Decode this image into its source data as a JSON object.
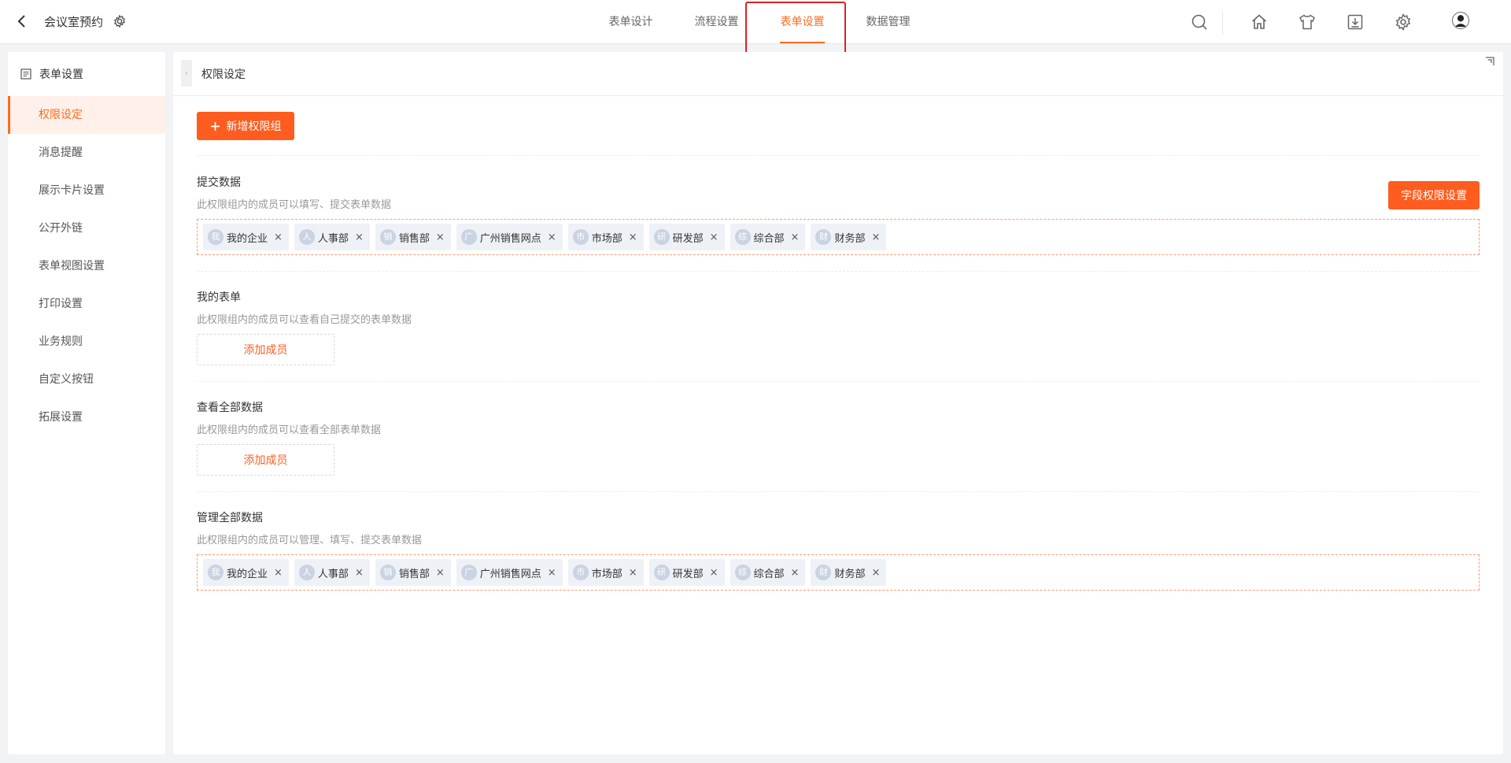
{
  "header": {
    "title": "会议室预约",
    "tabs": [
      "表单设计",
      "流程设置",
      "表单设置",
      "数据管理"
    ]
  },
  "sidebar": {
    "title": "表单设置",
    "items": [
      "权限设定",
      "消息提醒",
      "展示卡片设置",
      "公开外链",
      "表单视图设置",
      "打印设置",
      "业务规则",
      "自定义按钮",
      "拓展设置"
    ]
  },
  "main": {
    "title": "权限设定",
    "add_group_label": "新增权限组",
    "field_perm_label": "字段权限设置",
    "add_member_label": "添加成员",
    "sections": [
      {
        "title": "提交数据",
        "desc": "此权限组内的成员可以填写、提交表单数据"
      },
      {
        "title": "我的表单",
        "desc": "此权限组内的成员可以查看自己提交的表单数据"
      },
      {
        "title": "查看全部数据",
        "desc": "此权限组内的成员可以查看全部表单数据"
      },
      {
        "title": "管理全部数据",
        "desc": "此权限组内的成员可以管理、填写、提交表单数据"
      }
    ],
    "members": [
      {
        "avatar": "我",
        "name": "我的企业"
      },
      {
        "avatar": "人",
        "name": "人事部"
      },
      {
        "avatar": "销",
        "name": "销售部"
      },
      {
        "avatar": "广",
        "name": "广州销售网点"
      },
      {
        "avatar": "市",
        "name": "市场部"
      },
      {
        "avatar": "研",
        "name": "研发部"
      },
      {
        "avatar": "综",
        "name": "综合部"
      },
      {
        "avatar": "财",
        "name": "财务部"
      }
    ],
    "remove_symbol": "×"
  },
  "colors": {
    "accent": "#ff6a21",
    "button": "#ff5c1f",
    "highlight": "#e02020"
  }
}
